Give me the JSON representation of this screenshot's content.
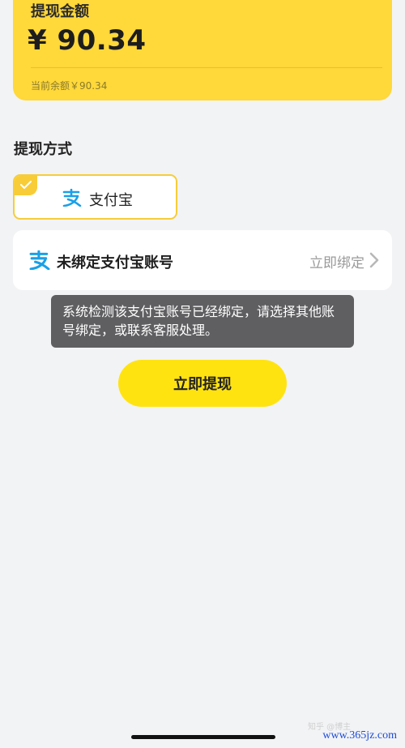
{
  "amount_card": {
    "label": "提现金额",
    "value": "¥ 90.34",
    "balance": "当前余额￥90.34"
  },
  "method_section": {
    "title": "提现方式",
    "option_label": "支付宝",
    "option_icon": "alipay-icon",
    "selected": true
  },
  "bind_row": {
    "label": "未绑定支付宝账号",
    "action": "立即绑定",
    "icon": "alipay-icon"
  },
  "toast": {
    "message": "系统检测该支付宝账号已经绑定，请选择其他账号绑定，或联系客服处理。"
  },
  "submit": {
    "label": "立即提现"
  },
  "watermark": {
    "text": "www.365jz.com",
    "faint": "知乎 @博主"
  },
  "colors": {
    "accent_yellow": "#ffd83a",
    "button_yellow": "#ffe311",
    "alipay_blue": "#1aa0e8",
    "background": "#f2f3f5"
  }
}
